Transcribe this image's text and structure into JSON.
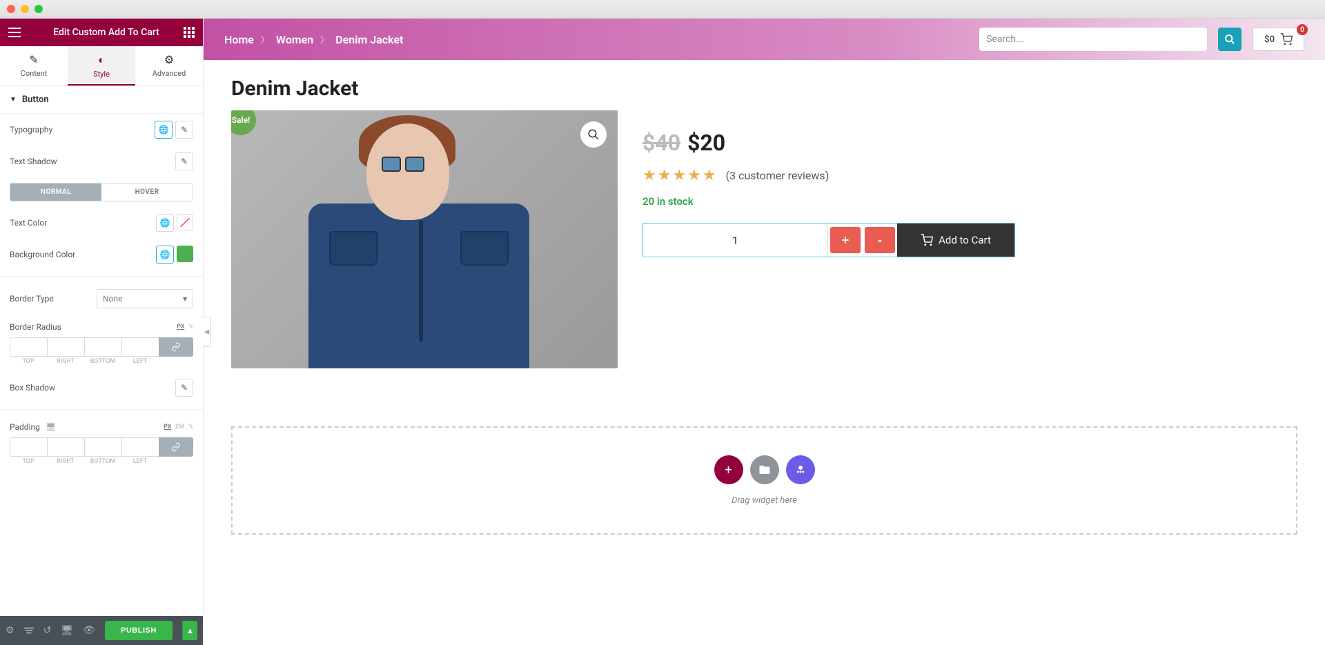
{
  "editor": {
    "title": "Edit Custom Add To Cart",
    "tabs": {
      "content": "Content",
      "style": "Style",
      "advanced": "Advanced"
    },
    "section": "Button",
    "controls": {
      "typography": "Typography",
      "text_shadow": "Text Shadow",
      "normal": "NORMAL",
      "hover": "HOVER",
      "text_color": "Text Color",
      "background_color": "Background Color",
      "border_type": "Border Type",
      "border_type_value": "None",
      "border_radius": "Border Radius",
      "box_shadow": "Box Shadow",
      "padding": "Padding"
    },
    "units": {
      "px": "PX",
      "pct": "%",
      "em": "EM"
    },
    "sides": {
      "top": "TOP",
      "right": "RIGHT",
      "bottom": "BOTTOM",
      "left": "LEFT"
    },
    "publish": "PUBLISH",
    "colors": {
      "bg_swatch": "#4caf50"
    }
  },
  "store": {
    "breadcrumb": [
      "Home",
      "Women",
      "Denim Jacket"
    ],
    "search_placeholder": "Search...",
    "cart_total": "$0",
    "cart_count": "0"
  },
  "product": {
    "title": "Denim Jacket",
    "sale_badge": "Sale!",
    "old_price": "$40",
    "new_price": "$20",
    "reviews": "(3 customer reviews)",
    "stock": "20 in stock",
    "qty": "1",
    "plus": "+",
    "minus": "-",
    "add_to_cart": "Add to Cart"
  },
  "drop_zone": {
    "text": "Drag widget here"
  }
}
